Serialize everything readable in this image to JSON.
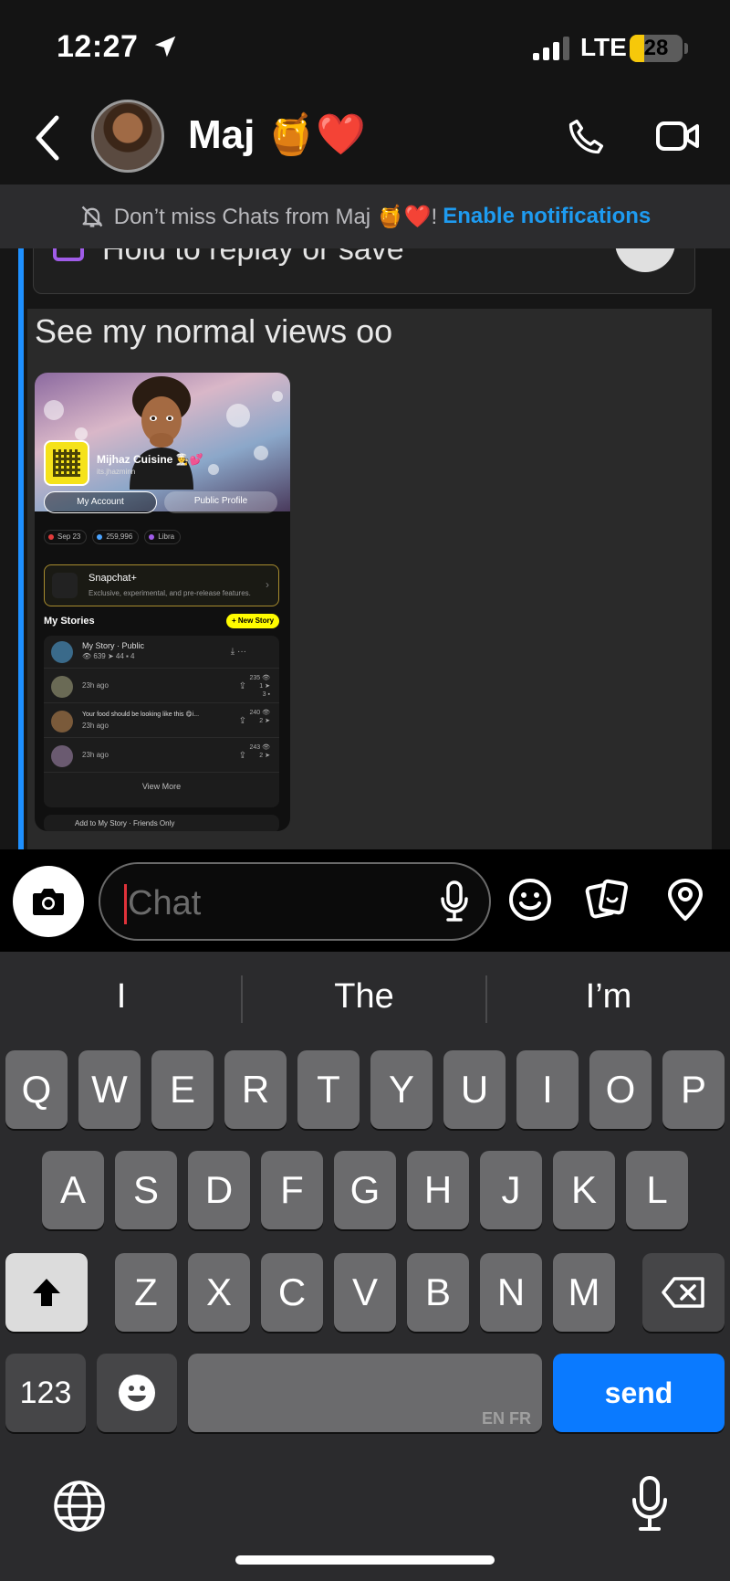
{
  "status_bar": {
    "time": "12:27",
    "network": "LTE",
    "battery": "28",
    "battery_level": 0.28
  },
  "header": {
    "contact_name": "Maj 🍯❤️"
  },
  "banner": {
    "text": "Don’t miss Chats from Maj 🍯❤️!",
    "link": "Enable notifications"
  },
  "chat": {
    "previous_card_text": "Hold to replay or save",
    "message_text": "See my normal views oo",
    "screenshot": {
      "profile_name": "Mijhaz Cuisine 👨‍🍳💕",
      "username": "its.jhazminn",
      "my_account_button": "My Account",
      "public_profile_button": "Public Profile",
      "chips": [
        "Sep 23",
        "259,996",
        "Libra"
      ],
      "snapchat_plus_title": "Snapchat+",
      "snapchat_plus_subtitle": "Exclusive, experimental, and pre-release features.",
      "my_stories_label": "My Stories",
      "new_story_button": "+ New Story",
      "stories": [
        {
          "title": "My Story · Public",
          "subtitle": "👁 639  ➤ 44  ▪ 4",
          "stats": ""
        },
        {
          "title": "",
          "subtitle": "23h ago",
          "stats": "235 👁\n1 ➤\n3 ▪"
        },
        {
          "title": "Your food should be looking like this 😋i...",
          "subtitle": "23h ago",
          "stats": "240 👁\n2 ➤"
        },
        {
          "title": "",
          "subtitle": "23h ago",
          "stats": "243 👁\n2 ➤"
        }
      ],
      "view_more": "View More",
      "add_story": "Add to My Story · Friends Only"
    }
  },
  "input": {
    "placeholder": "Chat"
  },
  "keyboard": {
    "suggestions": [
      "I",
      "The",
      "I’m"
    ],
    "row1": [
      "Q",
      "W",
      "E",
      "R",
      "T",
      "Y",
      "U",
      "I",
      "O",
      "P"
    ],
    "row2": [
      "A",
      "S",
      "D",
      "F",
      "G",
      "H",
      "J",
      "K",
      "L"
    ],
    "row3": [
      "Z",
      "X",
      "C",
      "V",
      "B",
      "N",
      "M"
    ],
    "numbers_key": "123",
    "space_langs": "EN FR",
    "send_key": "send"
  }
}
